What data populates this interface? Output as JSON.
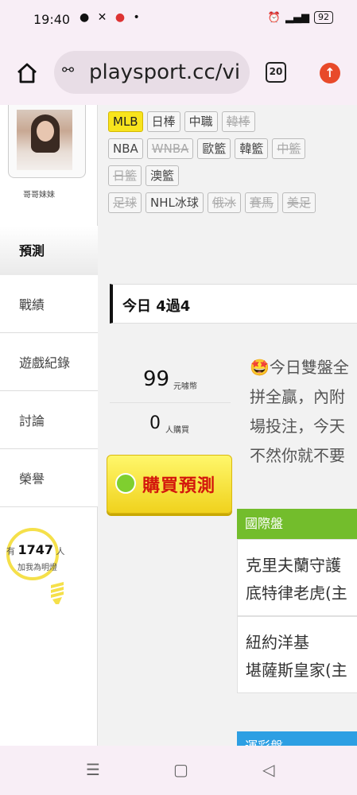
{
  "status_bar": {
    "time": "19:40",
    "battery": "92",
    "network": "4G"
  },
  "browser": {
    "url": "playsport.cc/vi",
    "tab_count": "20"
  },
  "profile": {
    "name": "哥哥妹妹"
  },
  "leagues": {
    "row1": [
      {
        "label": "MLB",
        "state": "active"
      },
      {
        "label": "日棒",
        "state": "on"
      },
      {
        "label": "中職",
        "state": "on"
      },
      {
        "label": "韓棒",
        "state": "off"
      }
    ],
    "row2": [
      {
        "label": "NBA",
        "state": "on"
      },
      {
        "label": "WNBA",
        "state": "off"
      },
      {
        "label": "歐籃",
        "state": "on"
      },
      {
        "label": "韓籃",
        "state": "on"
      },
      {
        "label": "中籃",
        "state": "off"
      }
    ],
    "row3": [
      {
        "label": "日籃",
        "state": "off"
      },
      {
        "label": "澳籃",
        "state": "on"
      }
    ],
    "row4": [
      {
        "label": "足球",
        "state": "off"
      },
      {
        "label": "NHL冰球",
        "state": "on"
      },
      {
        "label": "俄冰",
        "state": "off"
      },
      {
        "label": "賽馬",
        "state": "off"
      },
      {
        "label": "美足",
        "state": "off"
      }
    ]
  },
  "sidebar": {
    "predict": "預測",
    "items": [
      "戰績",
      "遊戲紀錄",
      "討論",
      "榮譽"
    ],
    "fans_prefix": "有",
    "fans_count": "1747",
    "fans_suffix": "人",
    "fans_cta": "加我為明燈"
  },
  "today_header": "今日 4過4",
  "purchase": {
    "price": "99",
    "price_unit": "元噱幣",
    "buyers": "0",
    "buyers_unit": "人購買",
    "buy_label": "購買預測"
  },
  "description": {
    "line1": "🤩今日雙盤全",
    "line2": "拼全贏，內附",
    "line3": "場投注，今天",
    "line4": "不然你就不要"
  },
  "sections": {
    "intl": "國際盤",
    "sports_lottery": "運彩盤"
  },
  "games": [
    {
      "team1": "克里夫蘭守護",
      "team2": "底特律老虎(主"
    },
    {
      "team1": "紐約洋基",
      "team2": "堪薩斯皇家(主"
    }
  ],
  "colors": {
    "active_tag": "#f8e41d",
    "intl_header": "#73bd2c",
    "sports_lottery_header": "#2d9fe3",
    "buy_text": "#d3160c"
  }
}
